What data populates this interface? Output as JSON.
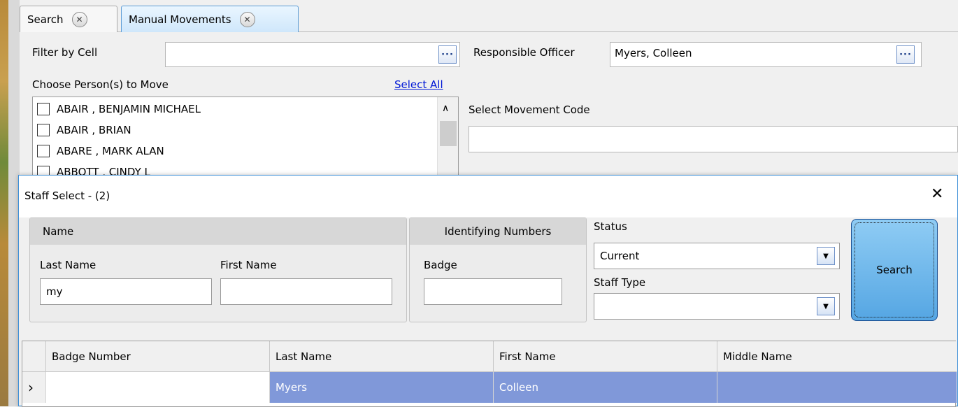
{
  "tabs": [
    {
      "label": "Search"
    },
    {
      "label": "Manual Movements"
    }
  ],
  "filter": {
    "label": "Filter by Cell",
    "value": "",
    "browse": "···"
  },
  "officer": {
    "label": "Responsible Officer",
    "value": "Myers, Colleen",
    "browse": "···"
  },
  "persons": {
    "label": "Choose Person(s) to Move",
    "select_all": "Select All",
    "items": [
      "ABAIR , BENJAMIN MICHAEL",
      "ABAIR , BRIAN",
      "ABARE , MARK ALAN",
      "ABBOTT , CINDY L"
    ]
  },
  "movement_code": {
    "label": "Select Movement Code",
    "value": ""
  },
  "dialog": {
    "title": "Staff Select - (2)",
    "close": "✕",
    "name_group": {
      "title": "Name",
      "last_label": "Last Name",
      "last_value": "my",
      "first_label": "First Name",
      "first_value": ""
    },
    "id_group": {
      "title": "Identifying Numbers",
      "badge_label": "Badge",
      "badge_value": ""
    },
    "status": {
      "label": "Status",
      "value": "Current"
    },
    "staff_type": {
      "label": "Staff Type",
      "value": ""
    },
    "search_button": "Search",
    "grid": {
      "columns": [
        "Badge Number",
        "Last Name",
        "First Name",
        "Middle Name"
      ],
      "rows": [
        {
          "indicator": "›",
          "badge": "",
          "last": "Myers",
          "first": "Colleen",
          "middle": ""
        }
      ]
    }
  },
  "colors": {
    "selected_row": "#8098d9",
    "link": "#0018d6",
    "accent": "#3c8fd8"
  }
}
